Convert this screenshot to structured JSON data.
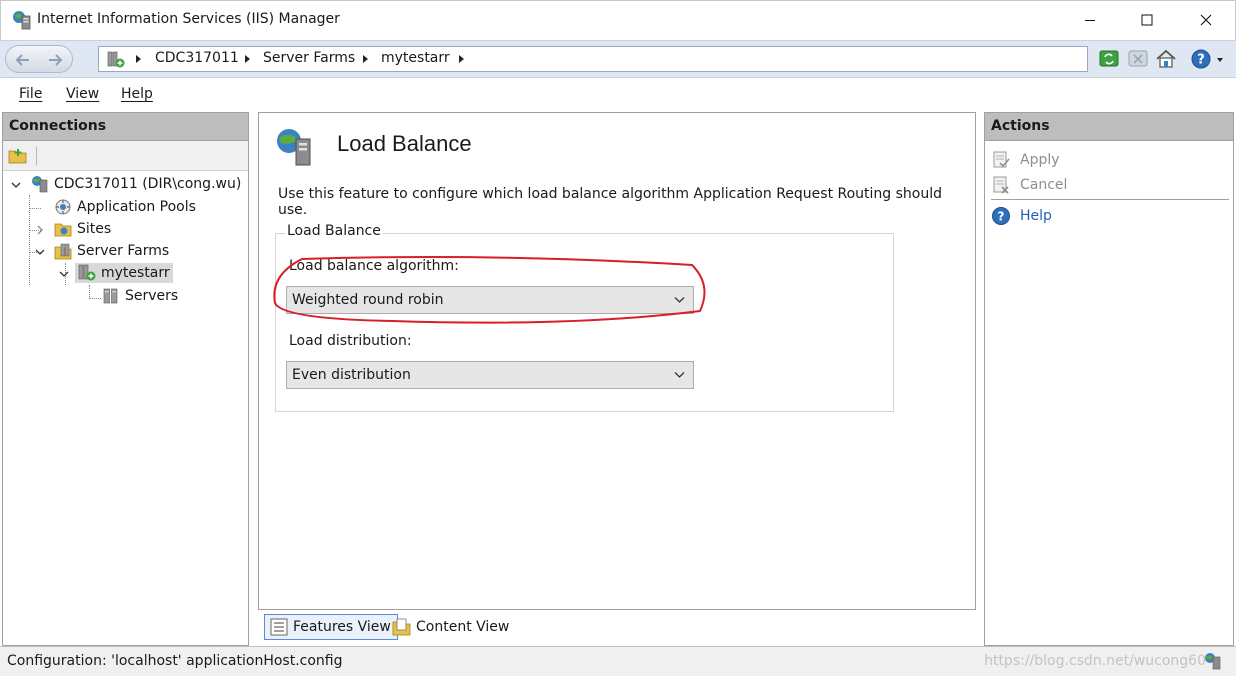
{
  "window": {
    "title": "Internet Information Services (IIS) Manager"
  },
  "address": {
    "crumbs": [
      "CDC317011",
      "Server Farms",
      "mytestarr"
    ]
  },
  "menu": {
    "file": "File",
    "view": "View",
    "help": "Help"
  },
  "connections": {
    "header": "Connections",
    "tree": {
      "server": "CDC317011 (DIR\\cong.wu)",
      "app_pools": "Application Pools",
      "sites": "Sites",
      "server_farms": "Server Farms",
      "farm": "mytestarr",
      "servers": "Servers"
    }
  },
  "content": {
    "title": "Load Balance",
    "description": "Use this feature to configure which load balance algorithm Application Request Routing should use.",
    "group_title": "Load Balance",
    "algorithm_label": "Load balance algorithm:",
    "algorithm_value": "Weighted round robin",
    "distribution_label": "Load distribution:",
    "distribution_value": "Even distribution"
  },
  "view_tabs": {
    "features": "Features View",
    "content": "Content View"
  },
  "actions": {
    "header": "Actions",
    "apply": "Apply",
    "cancel": "Cancel",
    "help": "Help"
  },
  "status": {
    "text": "Configuration: 'localhost' applicationHost.config",
    "watermark": "https://blog.csdn.net/wucong60"
  },
  "colors": {
    "highlight_ellipse": "#d61f2a",
    "address_bar": "#dfe7f2",
    "panel_header": "#bdbdbd",
    "help_link": "#1f5fb3"
  },
  "icons": {
    "app": "iis-manager-icon",
    "back": "back-arrow-icon",
    "forward": "forward-arrow-icon",
    "refresh": "refresh-icon",
    "stop": "stop-icon",
    "home": "home-icon",
    "help": "help-icon"
  }
}
